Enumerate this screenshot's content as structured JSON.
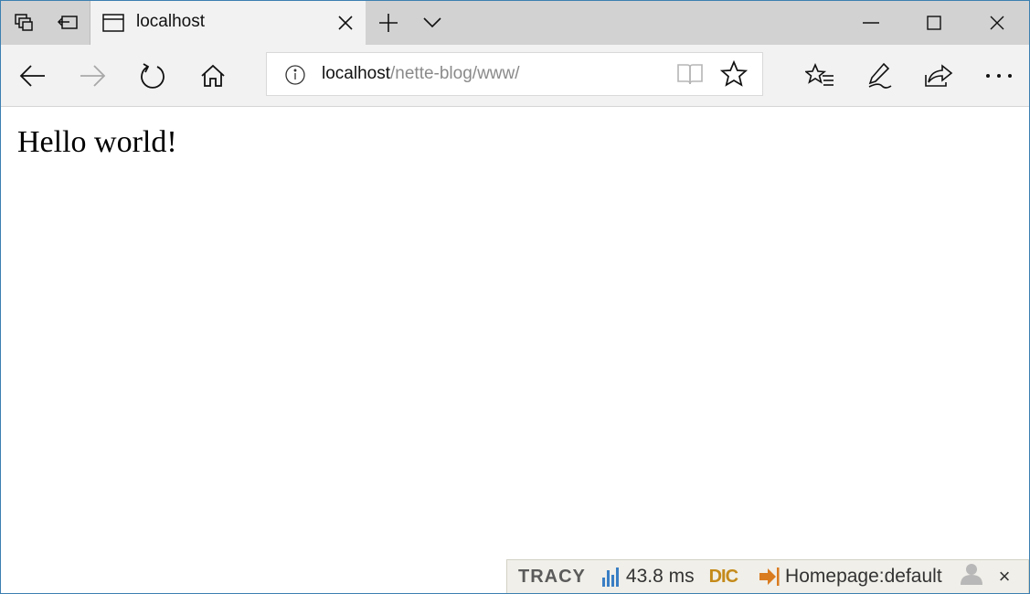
{
  "tab": {
    "title": "localhost"
  },
  "address": {
    "host": "localhost",
    "path": "/nette-blog/www/"
  },
  "page": {
    "heading": "Hello world!"
  },
  "tracy": {
    "logo": "TRACY",
    "time": "43.8 ms",
    "dic": "DIC",
    "route": "Homepage:default",
    "close": "×"
  },
  "window_controls": {
    "minimize": "—",
    "maximize": "☐",
    "close": "✕"
  },
  "colors": {
    "tracy_accent": "#c48a1a",
    "bar_chart": "#3a7fc4",
    "route_arrow": "#d97b1f"
  }
}
